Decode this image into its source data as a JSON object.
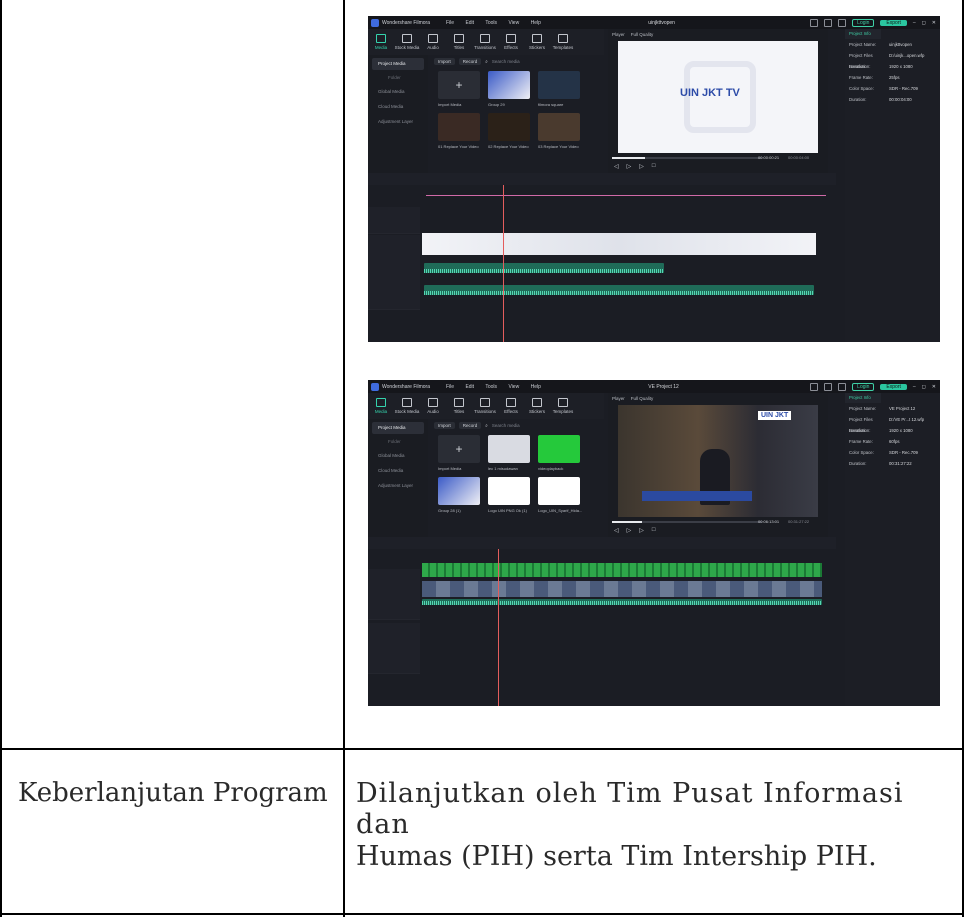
{
  "document": {
    "row_label": "Keberlanjutan Program",
    "row_value_line1": "Dilanjutkan oleh Tim Pusat Informasi dan",
    "row_value_line2": "Humas (PIH) serta Tim Intership PIH."
  },
  "screenshots": [
    {
      "app_name": "Wondershare Filmora",
      "menu": [
        "File",
        "Edit",
        "Tools",
        "View",
        "Help"
      ],
      "project_title": "uinjkttvopen",
      "login_label": "Login",
      "export_label": "Export",
      "tabs": [
        "Media",
        "Stock Media",
        "Audio",
        "Titles",
        "Transitions",
        "Effects",
        "Stickers",
        "Templates"
      ],
      "sidebar": [
        "Project Media",
        "Folder",
        "Global Media",
        "Cloud Media",
        "Adjustment Layer"
      ],
      "import_label": "Import",
      "record_label": "Record",
      "search_placeholder": "Search media",
      "media_items": [
        "Import Media",
        "Group 29",
        "filmora square",
        "01 Replace Your Video",
        "02 Replace Your Video",
        "03 Replace Your Video"
      ],
      "player_label": "Player",
      "quality_label": "Full Quality",
      "player_text": "UIN JKT TV",
      "current_time": "00:00:00:21",
      "total_time": "00:00:04:00",
      "info_tab": "Project Info",
      "info": [
        {
          "k": "Project Name:",
          "v": "uinjkttvopen"
        },
        {
          "k": "Project Files Location:",
          "v": "D:/uinjk...open.wfp"
        },
        {
          "k": "Resolution:",
          "v": "1920 x 1080"
        },
        {
          "k": "Frame Rate:",
          "v": "25fps"
        },
        {
          "k": "Color Space:",
          "v": "SDR - Rec.709"
        },
        {
          "k": "Duration:",
          "v": "00:00:04:00"
        }
      ]
    },
    {
      "app_name": "Wondershare Filmora",
      "menu": [
        "File",
        "Edit",
        "Tools",
        "View",
        "Help"
      ],
      "project_title": "VE Project 12",
      "login_label": "Login",
      "export_label": "Export",
      "tabs": [
        "Media",
        "Stock Media",
        "Audio",
        "Titles",
        "Transitions",
        "Effects",
        "Stickers",
        "Templates"
      ],
      "sidebar": [
        "Project Media",
        "Folder",
        "Global Media",
        "Cloud Media",
        "Adjustment Layer"
      ],
      "import_label": "Import",
      "record_label": "Record",
      "search_placeholder": "Search media",
      "media_items": [
        "Import Media",
        "lec 1 misudawan",
        "videoplayback",
        "Group 28 (1)",
        "Logo UIN PNG Ok (1)",
        "Logo_UIN_Syarif_Hida..."
      ],
      "player_label": "Player",
      "quality_label": "Full Quality",
      "player_text": "UIN JKT",
      "current_time": "00:06:13:01",
      "total_time": "00:31:27:22",
      "info_tab": "Project Info",
      "info": [
        {
          "k": "Project Name:",
          "v": "VE Project 12"
        },
        {
          "k": "Project Files Location:",
          "v": "D:/VE Pr...t 12.wfp"
        },
        {
          "k": "Resolution:",
          "v": "1920 x 1080"
        },
        {
          "k": "Frame Rate:",
          "v": "60fps"
        },
        {
          "k": "Color Space:",
          "v": "SDR - Rec.709"
        },
        {
          "k": "Duration:",
          "v": "00:31:27:22"
        }
      ]
    }
  ]
}
